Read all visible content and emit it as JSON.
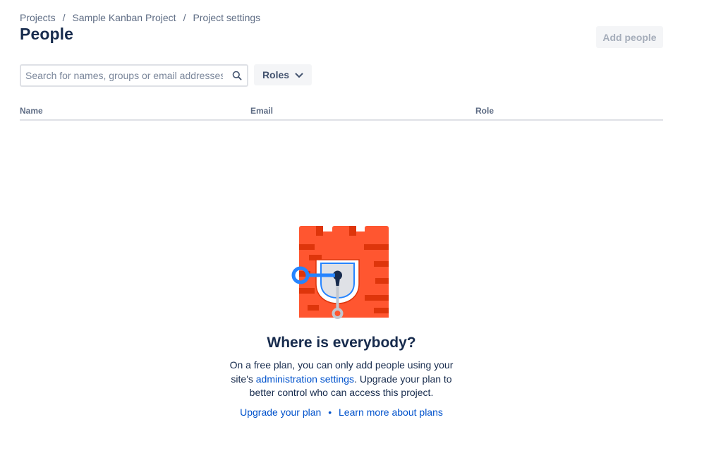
{
  "breadcrumb": {
    "items": [
      "Projects",
      "Sample Kanban Project",
      "Project settings"
    ],
    "separator": "/"
  },
  "page": {
    "title": "People"
  },
  "actions": {
    "add_people_label": "Add people",
    "add_people_disabled": true
  },
  "search": {
    "placeholder": "Search for names, groups or email addresses",
    "value": "",
    "icon": "search-icon"
  },
  "filters": {
    "roles_label": "Roles",
    "roles_icon": "chevron-down-icon"
  },
  "table": {
    "columns": [
      "Name",
      "Email",
      "Role"
    ],
    "rows": []
  },
  "empty_state": {
    "illustration": "locked-castle-illustration",
    "heading": "Where is everybody?",
    "body_before_link": "On a free plan, you can only add people using your site's ",
    "body_link": "administration settings",
    "body_after_link": ". Upgrade your plan to better control who can access this project.",
    "primary_link": "Upgrade your plan",
    "link_separator": "•",
    "secondary_link": "Learn more about plans"
  },
  "colors": {
    "text_primary": "#172b4d",
    "text_subtle": "#5e6c84",
    "link": "#0052cc",
    "button_bg": "#f4f5f7",
    "button_disabled_text": "#a5adba",
    "divider": "#dfe1e6",
    "castle_red": "#ff5630",
    "castle_dark": "#de350b",
    "key_blue": "#2684ff"
  }
}
